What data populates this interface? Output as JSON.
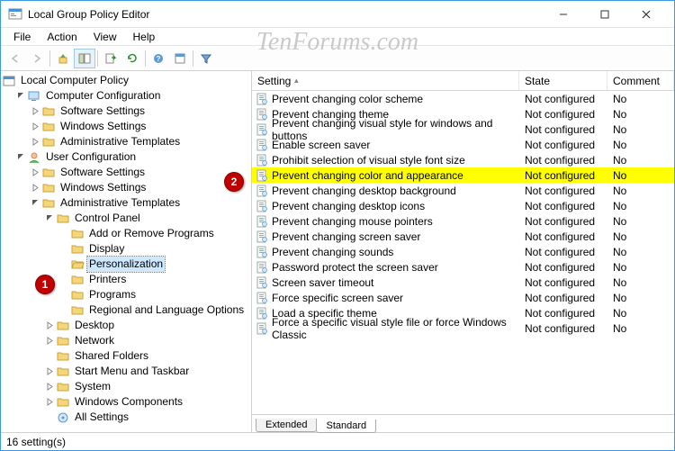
{
  "window": {
    "title": "Local Group Policy Editor"
  },
  "menubar": {
    "file": "File",
    "action": "Action",
    "view": "View",
    "help": "Help"
  },
  "tree": {
    "root": "Local Computer Policy",
    "computer_config": "Computer Configuration",
    "cc_software": "Software Settings",
    "cc_windows": "Windows Settings",
    "cc_admin": "Administrative Templates",
    "user_config": "User Configuration",
    "uc_software": "Software Settings",
    "uc_windows": "Windows Settings",
    "uc_admin": "Administrative Templates",
    "cp": "Control Panel",
    "cp_add_remove": "Add or Remove Programs",
    "cp_display": "Display",
    "cp_personalization": "Personalization",
    "cp_printers": "Printers",
    "cp_programs": "Programs",
    "cp_regional": "Regional and Language Options",
    "desktop": "Desktop",
    "network": "Network",
    "shared": "Shared Folders",
    "start_taskbar": "Start Menu and Taskbar",
    "system": "System",
    "win_comp": "Windows Components",
    "all_settings": "All Settings"
  },
  "list": {
    "header": {
      "setting": "Setting",
      "state": "State",
      "comment": "Comment"
    },
    "rows": [
      {
        "setting": "Prevent changing color scheme",
        "state": "Not configured",
        "comment": "No"
      },
      {
        "setting": "Prevent changing theme",
        "state": "Not configured",
        "comment": "No"
      },
      {
        "setting": "Prevent changing visual style for windows and buttons",
        "state": "Not configured",
        "comment": "No"
      },
      {
        "setting": "Enable screen saver",
        "state": "Not configured",
        "comment": "No"
      },
      {
        "setting": "Prohibit selection of visual style font size",
        "state": "Not configured",
        "comment": "No"
      },
      {
        "setting": "Prevent changing color and appearance",
        "state": "Not configured",
        "comment": "No",
        "highlight": true
      },
      {
        "setting": "Prevent changing desktop background",
        "state": "Not configured",
        "comment": "No"
      },
      {
        "setting": "Prevent changing desktop icons",
        "state": "Not configured",
        "comment": "No"
      },
      {
        "setting": "Prevent changing mouse pointers",
        "state": "Not configured",
        "comment": "No"
      },
      {
        "setting": "Prevent changing screen saver",
        "state": "Not configured",
        "comment": "No"
      },
      {
        "setting": "Prevent changing sounds",
        "state": "Not configured",
        "comment": "No"
      },
      {
        "setting": "Password protect the screen saver",
        "state": "Not configured",
        "comment": "No"
      },
      {
        "setting": "Screen saver timeout",
        "state": "Not configured",
        "comment": "No"
      },
      {
        "setting": "Force specific screen saver",
        "state": "Not configured",
        "comment": "No"
      },
      {
        "setting": "Load a specific theme",
        "state": "Not configured",
        "comment": "No"
      },
      {
        "setting": "Force a specific visual style file or force Windows Classic",
        "state": "Not configured",
        "comment": "No"
      }
    ]
  },
  "tabs": {
    "extended": "Extended",
    "standard": "Standard"
  },
  "statusbar": {
    "text": "16 setting(s)"
  },
  "callouts": {
    "one": "1",
    "two": "2"
  },
  "watermark": "TenForums.com"
}
